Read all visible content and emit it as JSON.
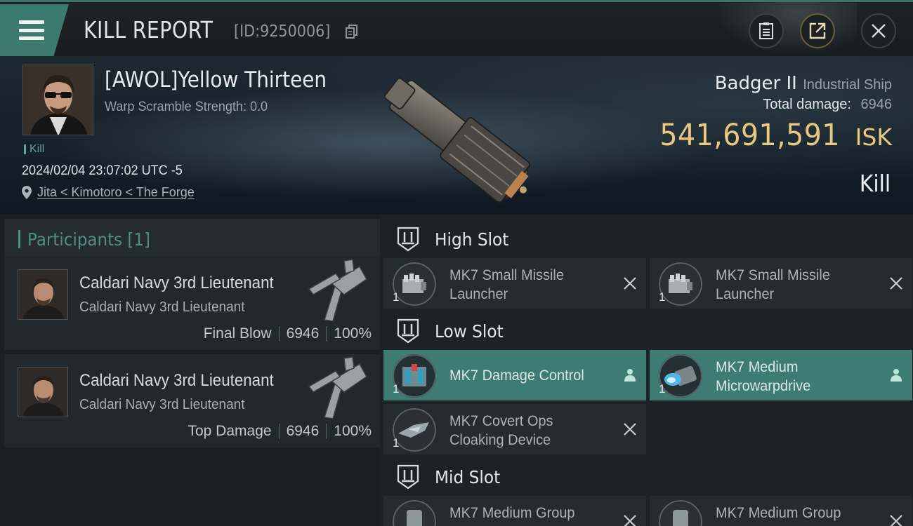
{
  "header": {
    "title": "KILL REPORT",
    "kill_id": "[ID:9250006]"
  },
  "victim": {
    "name": "[AWOL]Yellow Thirteen",
    "warp_scramble": "Warp Scramble Strength: 0.0",
    "tag": "Kill",
    "datetime": "2024/02/04 23:07:02 UTC -5",
    "location": "Jita < Kimotoro < The Forge"
  },
  "ship": {
    "name": "Badger II",
    "class": "Industrial Ship",
    "damage_label": "Total damage:",
    "damage_value": "6946",
    "isk_value": "541,691,591",
    "isk_unit": "ISK",
    "result": "Kill"
  },
  "participants": {
    "header": "Participants [1]",
    "list": [
      {
        "name": "Caldari Navy 3rd Lieutenant",
        "corp": "Caldari Navy 3rd Lieutenant",
        "role": "Final Blow",
        "damage": "6946",
        "percent": "100%"
      },
      {
        "name": "Caldari Navy 3rd Lieutenant",
        "corp": "Caldari Navy 3rd Lieutenant",
        "role": "Top Damage",
        "damage": "6946",
        "percent": "100%"
      }
    ]
  },
  "slots": {
    "high": {
      "title": "High Slot",
      "modules": [
        {
          "name": "MK7 Small Missile Launcher",
          "qty": "1",
          "status": "destroyed",
          "icon": "missile-launcher-icon"
        },
        {
          "name": "MK7 Small Missile Launcher",
          "qty": "1",
          "status": "destroyed",
          "icon": "missile-launcher-icon"
        }
      ]
    },
    "low": {
      "title": "Low Slot",
      "modules": [
        {
          "name": "MK7 Damage Control",
          "qty": "1",
          "status": "dropped",
          "icon": "damage-control-icon"
        },
        {
          "name": "MK7 Medium Microwarpdrive",
          "qty": "1",
          "status": "dropped",
          "icon": "microwarpdrive-icon"
        },
        {
          "name": "MK7 Covert Ops Cloaking Device",
          "qty": "1",
          "status": "destroyed",
          "icon": "cloaking-device-icon"
        }
      ]
    },
    "mid": {
      "title": "Mid Slot",
      "modules": [
        {
          "name": "MK7 Medium Group",
          "qty": "1",
          "status": "destroyed",
          "icon": "shield-module-icon"
        },
        {
          "name": "MK7 Medium Group",
          "qty": "1",
          "status": "destroyed",
          "icon": "shield-module-icon"
        }
      ]
    }
  },
  "colors": {
    "accent": "#3e7b72",
    "isk": "#e9c77f",
    "background": "#1c2225"
  }
}
